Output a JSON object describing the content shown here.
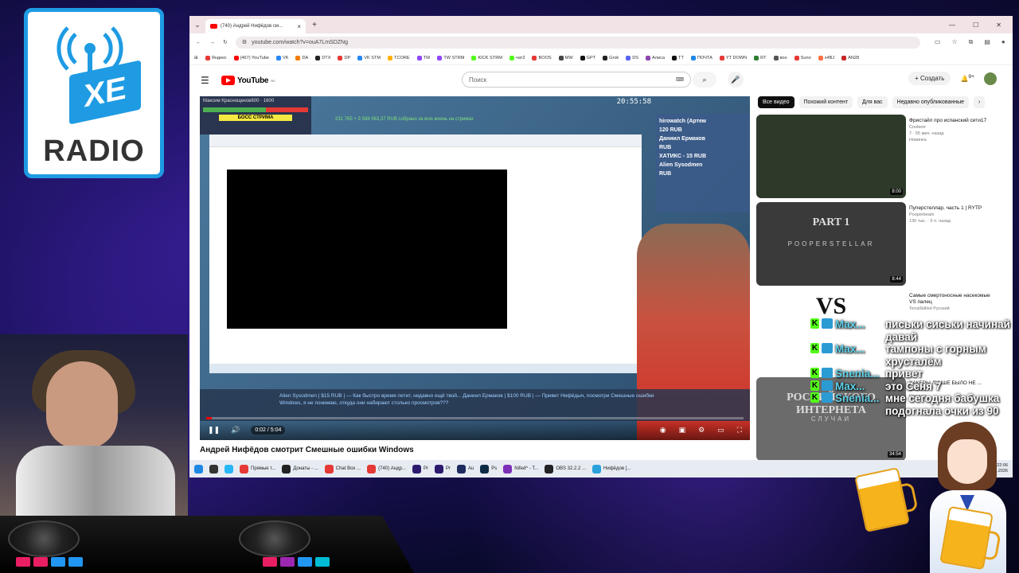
{
  "logo": {
    "badge": "XE",
    "text": "RADIO"
  },
  "browser": {
    "tab_title": "(740) Андрей Нифёдов см...",
    "url": "youtube.com/watch?v=ouA7LmSDZNg",
    "bookmarks": [
      {
        "label": "Яндекс",
        "color": "#e53935"
      },
      {
        "label": "(467) YouTube",
        "color": "#ff0000"
      },
      {
        "label": "VK",
        "color": "#2787f5"
      },
      {
        "label": "DA",
        "color": "#f57c00"
      },
      {
        "label": "DTX",
        "color": "#222222"
      },
      {
        "label": "DP",
        "color": "#e53935"
      },
      {
        "label": "VK STM",
        "color": "#2787f5"
      },
      {
        "label": "TCORE",
        "color": "#ffb300"
      },
      {
        "label": "TW",
        "color": "#9146ff"
      },
      {
        "label": "TW STRM",
        "color": "#9146ff"
      },
      {
        "label": "KICK STRM",
        "color": "#53fc18"
      },
      {
        "label": "чат2",
        "color": "#53fc18"
      },
      {
        "label": "BOOS",
        "color": "#e53935"
      },
      {
        "label": "MW",
        "color": "#444444"
      },
      {
        "label": "GPT",
        "color": "#111111"
      },
      {
        "label": "Grok",
        "color": "#222222"
      },
      {
        "label": "DS",
        "color": "#5865f2"
      },
      {
        "label": "Алиса",
        "color": "#8e44ad"
      },
      {
        "label": "TT",
        "color": "#111111"
      },
      {
        "label": "ПОЧТА",
        "color": "#1e88e5"
      },
      {
        "label": "YT DOWN",
        "color": "#e53935"
      },
      {
        "label": "RT",
        "color": "#2e7d32"
      },
      {
        "label": "вон",
        "color": "#555555"
      },
      {
        "label": "Suno",
        "color": "#e53935"
      },
      {
        "label": "x4BJ",
        "color": "#ff7043"
      },
      {
        "label": "AN28",
        "color": "#c62828"
      }
    ]
  },
  "youtube": {
    "logo_text": "YouTube",
    "logo_region": "RU",
    "search_placeholder": "Поиск",
    "create_label": "Создать",
    "notif_count": "9+",
    "video_title": "Андрей Нифёдов смотрит Смешные ошибки Windows",
    "player": {
      "time": "0:02 / 5:04",
      "progress": 0.01,
      "overlay_name": "Максим Краснощеков600 · 1600",
      "boss_label": "БОСС СТРИМА",
      "stream_clock": "20:55:58",
      "donation_total": "231 765 + 3 588 063,37 RUB собрано за всю жизнь на стримах",
      "donors": [
        "hirowatch (Артем",
        "120 RUB",
        "Даниил Ермаков",
        "RUB",
        "ХАТИКС - 15 RUB",
        "Alien Sysodmen",
        "RUB"
      ],
      "ticker": "Alien Sysodmen | $15 RUB | — Как быстро время летит, недавно ещё твой... Даниил Ермаков | $100 RUB | — Привет Нифёдыч, посмотри Смешные ошибки Windows, я не понимаю, откуда они набирают столько просмотров???"
    },
    "chips": [
      "Все видео",
      "Похожий контент",
      "Для вас",
      "Недавно опубликованные"
    ],
    "recommendations": [
      {
        "title": "Фристайл про испанский сити17",
        "channel": "Coobeer",
        "stats": "7 · 55 мин. назад",
        "badge": "Новинка",
        "duration": "8:00",
        "top_color": "#2d3a2a"
      },
      {
        "title": "Пуперстеллар, часть 1 | RYTP",
        "channel": "Pooperbeam",
        "stats": "136 тыс. · 9 л. назад",
        "badge": "",
        "duration": "8:44",
        "top_color": "#3a3a3a",
        "overlay": "PART 1",
        "overlay2": "POOPERSTELLAR"
      },
      {
        "title": "Самые смертоносные насекомые VS палец",
        "channel": "TerraSkilled Русский",
        "stats": "",
        "badge": "",
        "duration": "",
        "top_color": "#ffffff",
        "overlay": "VS"
      },
      {
        "title": "ХАКЕРЫ ЛУЧШЕ БЫЛО НЕ ... Самые",
        "channel": "",
        "stats": "",
        "badge": "Новинка",
        "duration": "34:54",
        "top_color": "#6b6b6b",
        "overlay": "РОССИЙСКОГО ИНТЕРНЕТА",
        "overlay2": "СЛУЧАИ"
      }
    ]
  },
  "taskbar": {
    "items": [
      {
        "label": "Прямые т...",
        "color": "#e53935"
      },
      {
        "label": "Донаты - ...",
        "color": "#222222"
      },
      {
        "label": "Chat Box ...",
        "color": "#e53935"
      },
      {
        "label": "(740) Андр...",
        "color": "#e53935"
      },
      {
        "label": "Pr",
        "color": "#2d1a6e"
      },
      {
        "label": "Pr",
        "color": "#2d1a6e"
      },
      {
        "label": "Au",
        "color": "#1d2b5e"
      },
      {
        "label": "Ps",
        "color": "#0b2b45"
      },
      {
        "label": "Nifed^ - T...",
        "color": "#7e2fb8"
      },
      {
        "label": "OBS 32.2.2 ...",
        "color": "#222222"
      },
      {
        "label": "Нифёдов [...",
        "color": "#2aa1da"
      }
    ],
    "clock": [
      "22:06",
      "19.08.2026"
    ]
  },
  "chat": [
    {
      "user": "Max...",
      "text": "письки сиськи начинай давай"
    },
    {
      "user": "Max...",
      "text": "тампоны с горным хрусталём"
    },
    {
      "user": "Snenia...",
      "text": "привет"
    },
    {
      "user": "Max...",
      "text": "это Сеня 7"
    },
    {
      "user": "Snenia...",
      "text": "мне сегодня бабушка подогнала очки из 90"
    }
  ]
}
